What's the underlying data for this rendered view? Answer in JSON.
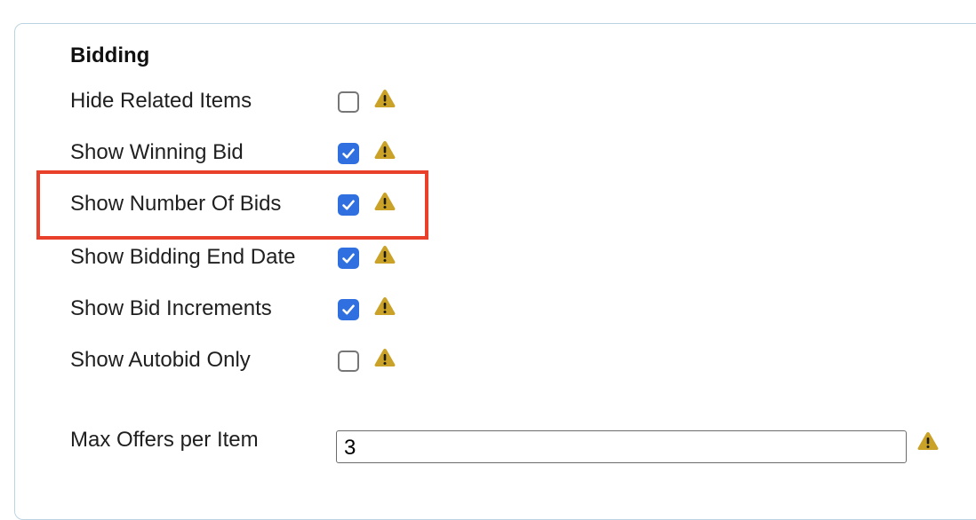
{
  "section": {
    "title": "Bidding"
  },
  "settings": [
    {
      "label": "Hide Related Items",
      "checked": false
    },
    {
      "label": "Show Winning Bid",
      "checked": true
    },
    {
      "label": "Show Number Of Bids",
      "checked": true
    },
    {
      "label": "Show Bidding End Date",
      "checked": true
    },
    {
      "label": "Show Bid Increments",
      "checked": true
    },
    {
      "label": "Show Autobid Only",
      "checked": false
    }
  ],
  "max_offers": {
    "label": "Max Offers per Item",
    "value": "3"
  },
  "colors": {
    "checkbox_checked": "#2f6fe0",
    "warning_icon": "#c9a227",
    "highlight_border": "#e8402a",
    "panel_border": "#bcd3e3"
  },
  "icons": {
    "warning": "warning-triangle-icon"
  },
  "highlighted_setting": "Show Number Of Bids"
}
